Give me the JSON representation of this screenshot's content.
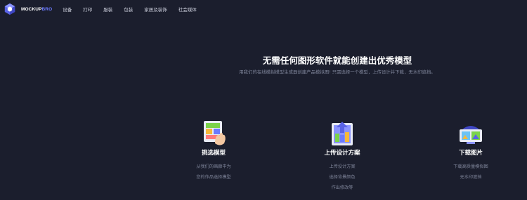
{
  "brand": {
    "name_main": "MOCKUP",
    "name_accent": "BRO",
    "accent_color": "#6c7bff"
  },
  "nav": {
    "items": [
      "设备",
      "打印",
      "服装",
      "包装",
      "家居及装饰",
      "社会媒体"
    ]
  },
  "hero": {
    "title": "无需任何图形软件就能创建出优秀模型",
    "subtitle": "用我们的在线模拟模型生成器创建产品模拟图! 只需选择一个模型，上传设计并下载，无水印遮挡。"
  },
  "features": [
    {
      "icon": "pick-template-icon",
      "title": "挑选模型",
      "desc": [
        "从我们的画廊中为",
        "您的作品选择模型"
      ]
    },
    {
      "icon": "upload-design-icon",
      "title": "上传设计方案",
      "desc": [
        "上传设计方案",
        "选择背景颜色",
        "作出修改等"
      ]
    },
    {
      "icon": "download-image-icon",
      "title": "下载图片",
      "desc": [
        "下载高质量模拟图",
        "无水印遮挡"
      ]
    }
  ]
}
